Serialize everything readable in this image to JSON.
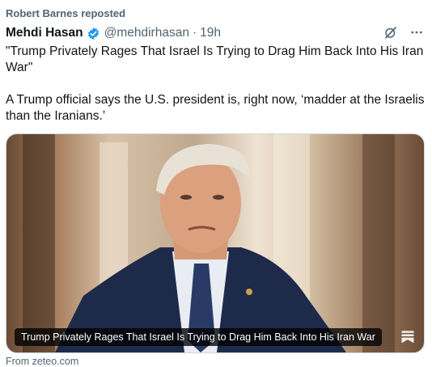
{
  "repost_line": "Robert Barnes reposted",
  "author": {
    "name": "Mehdi Hasan",
    "handle": "@mehdirhasan",
    "separator": "·",
    "time": "19h",
    "verified_color": "#1d9bf0"
  },
  "tweet": {
    "text": "\"Trump Privately Rages That Israel Is Trying to Drag Him Back Into His Iran War\"\n\nA Trump official says the U.S. president is, right now, ‘madder at the Israelis than the Iranians.’"
  },
  "card": {
    "caption": "Trump Privately Rages That Israel Is Trying to Drag Him Back Into His Iran War",
    "source": "From zeteo.com"
  },
  "icons": {
    "grok": "grok-icon",
    "more": "more-icon",
    "verified": "verified-badge-icon",
    "bookmark": "bookmark-icon"
  }
}
